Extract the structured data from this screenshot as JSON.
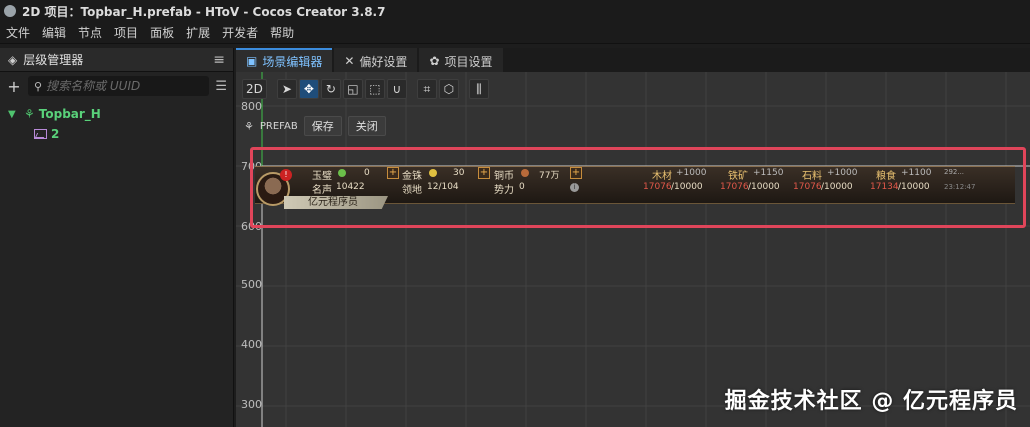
{
  "window": {
    "title": "2D 项目：Topbar_H.prefab - HToV - Cocos Creator 3.8.7"
  },
  "menu": [
    "文件",
    "编辑",
    "节点",
    "项目",
    "面板",
    "扩展",
    "开发者",
    "帮助"
  ],
  "hierarchy": {
    "tab_label": "层级管理器",
    "search_placeholder": "搜索名称或 UUID",
    "nodes": [
      {
        "label": "Topbar_H"
      },
      {
        "label": "2"
      }
    ]
  },
  "editor_tabs": [
    {
      "label": "场景编辑器"
    },
    {
      "label": "偏好设置"
    },
    {
      "label": "项目设置"
    }
  ],
  "scene": {
    "mode_label": "2D",
    "prefab_label": "PREFAB",
    "save_label": "保存",
    "close_label": "关闭",
    "ruler": [
      "800",
      "700",
      "600",
      "500",
      "400",
      "300"
    ]
  },
  "topbar": {
    "jade_label": "玉璧",
    "jade_value": "0",
    "gold_label": "金铢",
    "gold_value": "30",
    "copper_label": "铜币",
    "copper_value": "77万",
    "fame_label": "名声",
    "fame_value": "10422",
    "land_label": "领地",
    "land_value": "12/104",
    "power_label": "势力",
    "power_value": "0",
    "player_name": "亿元程序员",
    "wood": {
      "label": "木材",
      "rate": "+1000",
      "current": "17076",
      "max": "/10000"
    },
    "iron": {
      "label": "铁矿",
      "rate": "+1150",
      "current": "17076",
      "max": "/10000"
    },
    "stone": {
      "label": "石料",
      "rate": "+1000",
      "current": "17076",
      "max": "/10000"
    },
    "grain": {
      "label": "粮食",
      "rate": "+1100",
      "current": "17134",
      "max": "/10000"
    },
    "extra_top": "292...",
    "extra_bottom": "23:12:47"
  },
  "watermark": "掘金技术社区 @ 亿元程序员"
}
